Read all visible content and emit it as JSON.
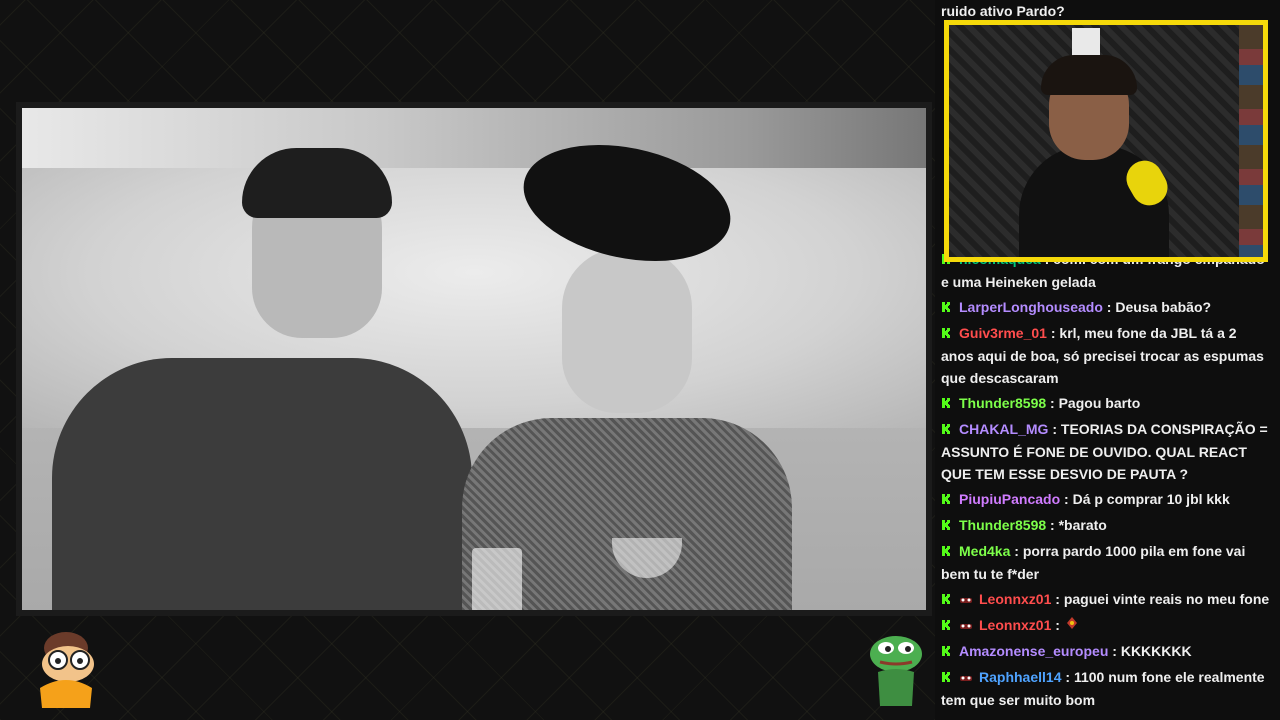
{
  "chat": {
    "messages": [
      {
        "user": "",
        "text": "ruido ativo Pardo?",
        "user_color": "#efefef",
        "badge": "none"
      },
      {
        "user": "nicomaquea",
        "text": "comi com um frango empanado e uma Heineken gelada",
        "user_color": "#00c87a",
        "badge": "kick"
      },
      {
        "user": "LarperLonghouseado",
        "text": "Deusa babão?",
        "user_color": "#b48cff",
        "badge": "kick"
      },
      {
        "user": "Guiv3rme_01",
        "text": "krl, meu fone da JBL tá a 2 anos aqui de boa, só precisei trocar as espumas que descascaram",
        "user_color": "#ff4d4d",
        "badge": "kick"
      },
      {
        "user": "Thunder8598",
        "text": "Pagou barto",
        "user_color": "#7dff4a",
        "badge": "kick"
      },
      {
        "user": "CHAKAL_MG",
        "text": "TEORIAS DA CONSPIRAÇÃO = ASSUNTO É FONE DE OUVIDO. QUAL REACT QUE TEM ESSE DESVIO DE PAUTA ?",
        "user_color": "#b48cff",
        "badge": "kick"
      },
      {
        "user": "PiupiuPancado",
        "text": "Dá p comprar 10 jbl kkk",
        "user_color": "#d07cff",
        "badge": "kick"
      },
      {
        "user": "Thunder8598",
        "text": "*barato",
        "user_color": "#7dff4a",
        "badge": "kick"
      },
      {
        "user": "Med4ka",
        "text": "porra pardo 1000 pila em fone vai bem tu te f*der",
        "user_color": "#7dff4a",
        "badge": "kick"
      },
      {
        "user": "Leonnxz01",
        "text": "paguei vinte reais no meu fone",
        "user_color": "#ff4d4d",
        "badge": "kick-sub"
      },
      {
        "user": "Leonnxz01",
        "text": "",
        "user_color": "#ff4d4d",
        "badge": "kick-sub"
      },
      {
        "user": "Amazonense_europeu",
        "text": "KKKKKKK",
        "user_color": "#b48cff",
        "badge": "kick"
      },
      {
        "user": "Raphhaell14",
        "text": "1100 num fone ele realmente tem que ser muito bom",
        "user_color": "#4fa3ff",
        "badge": "kick-sub"
      }
    ],
    "separator": " : "
  },
  "colors": {
    "kick_green": "#53fc18",
    "cam_border": "#f5d90a",
    "background": "#0d0d0d"
  },
  "icons": {
    "badge": "kick-logo-icon",
    "emote_left": "cartoon-glasses-emote-icon",
    "emote_right": "pepe-frog-emote-icon"
  }
}
